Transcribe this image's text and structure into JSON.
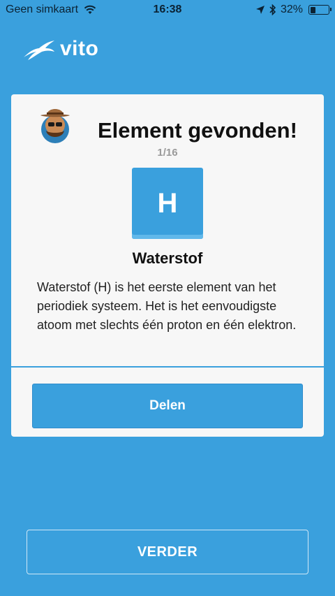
{
  "status_bar": {
    "carrier": "Geen simkaart",
    "time": "16:38",
    "battery_percent": "32%",
    "battery_level": 0.32,
    "icons": [
      "wifi-icon",
      "location-arrow-icon",
      "bluetooth-icon",
      "battery-icon"
    ]
  },
  "app": {
    "logo_text": "vito",
    "logo_icon": "bird-logo-icon"
  },
  "card": {
    "title": "Element gevonden!",
    "avatar_icon": "explorer-avatar-icon",
    "counter": "1/16",
    "element": {
      "symbol": "H",
      "name": "Waterstof",
      "description": "Waterstof (H) is het eerste element van het periodiek systeem. Het is het eenvoudigste atoom met slechts één proton en één elektron."
    },
    "share_label": "Delen"
  },
  "next_label": "VERDER",
  "colors": {
    "background": "#3aa0dd",
    "card": "#f7f7f7",
    "accent": "#3aa0dd"
  }
}
